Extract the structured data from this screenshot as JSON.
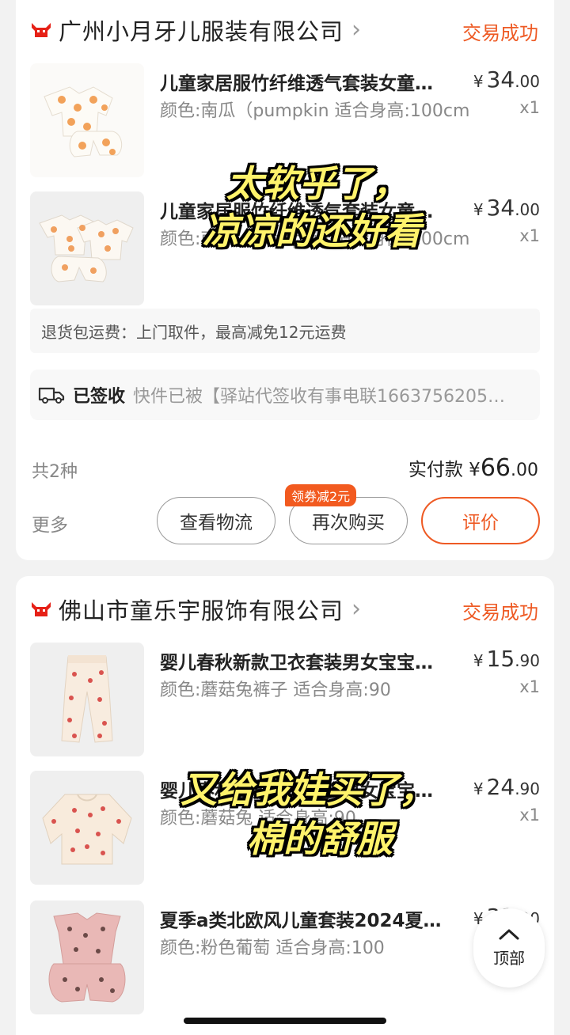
{
  "orders": [
    {
      "shop_name": "广州小月牙儿服装有限公司",
      "status": "交易成功",
      "items": [
        {
          "title": "儿童家居服竹纤维透气套装女童…",
          "spec": "颜色:南瓜（pumpkin 适合身高:100cm",
          "price_int": "34",
          "price_dec": ".00",
          "qty": "x1"
        },
        {
          "title": "儿童家居服竹纤维透气套装女童…",
          "spec": "颜色:南瓜（pumpkin 适合身高:100cm",
          "price_int": "34",
          "price_dec": ".00",
          "qty": "x1"
        }
      ],
      "return_note": "退货包运费：上门取件，最高减免12元运费",
      "logistics": {
        "status": "已签收",
        "detail": "快件已被【驿站代签收有事电联1663756205…"
      },
      "kinds": "共2种",
      "paid_label": "实付款",
      "paid_int": "66",
      "paid_dec": ".00",
      "more": "更多",
      "buttons": {
        "track": "查看物流",
        "rebuy": "再次购买",
        "review": "评价"
      },
      "coupon": "领券减2元"
    },
    {
      "shop_name": "佛山市童乐宇服饰有限公司",
      "status": "交易成功",
      "items": [
        {
          "title": "婴儿春秋新款卫衣套装男女宝宝…",
          "spec": "颜色:蘑菇兔裤子 适合身高:90",
          "price_int": "15",
          "price_dec": ".90",
          "qty": "x1"
        },
        {
          "title": "婴儿春秋新款卫衣套装男女宝宝…",
          "spec": "颜色:蘑菇兔 适合身高:90",
          "price_int": "24",
          "price_dec": ".90",
          "qty": "x1"
        },
        {
          "title": "夏季a类北欧风儿童套装2024夏…",
          "spec": "颜色:粉色葡萄 适合身高:100",
          "price_int": "33",
          "price_dec": ".90",
          "qty": "x1"
        }
      ]
    }
  ],
  "currency": "¥",
  "overlay_captions": [
    {
      "line1": "太软乎了，",
      "line2": "凉凉的还好看"
    },
    {
      "line1": "又给我娃买了，",
      "line2": "棉的舒服"
    }
  ],
  "float_button": {
    "label": "顶部"
  },
  "colors": {
    "accent": "#ee5a24",
    "caption": "#fff36b"
  }
}
